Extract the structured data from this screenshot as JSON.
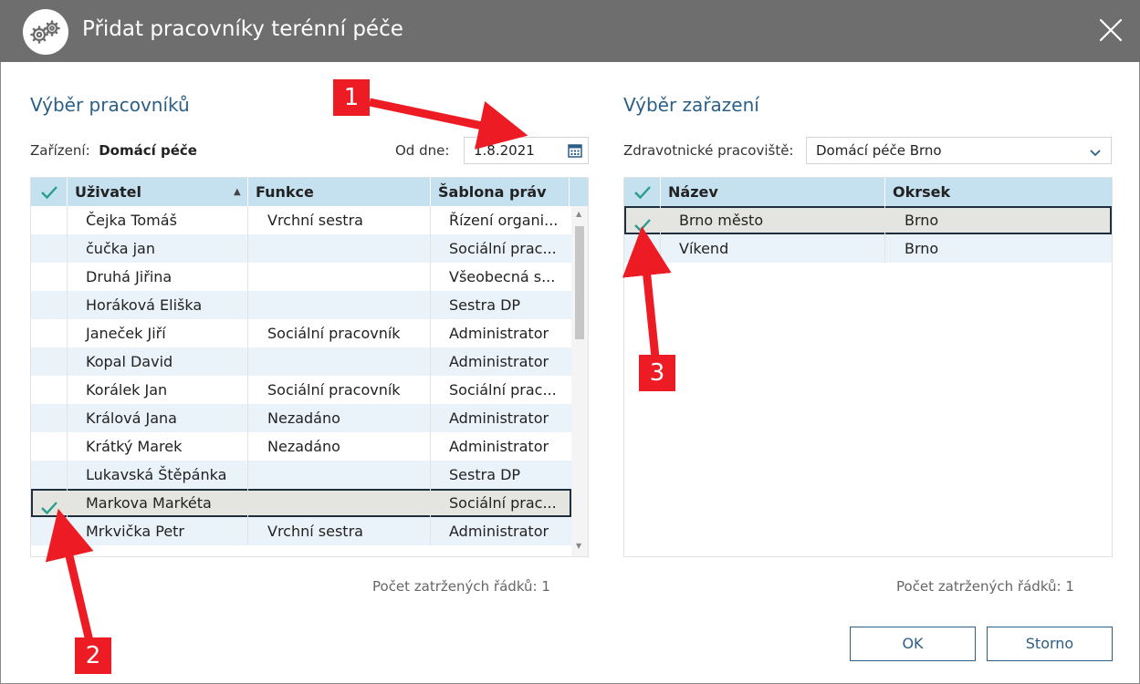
{
  "window": {
    "title": "Přidat pracovníky terénní péče"
  },
  "left": {
    "section_title": "Výběr pracovníků",
    "facility_label": "Zařízení:",
    "facility_value": "Domácí péče",
    "from_label": "Od dne:",
    "from_value": "1.8.2021",
    "columns": [
      "Uživatel",
      "Funkce",
      "Šablona práv"
    ],
    "rows": [
      {
        "name": "Čejka Tomáš",
        "function": "Vrchní sestra",
        "template": "Řízení organi...",
        "checked": false
      },
      {
        "name": "čučka jan",
        "function": "",
        "template": "Sociální prac...",
        "checked": false
      },
      {
        "name": "Druhá Jiřina",
        "function": "",
        "template": "Všeobecná s...",
        "checked": false
      },
      {
        "name": "Horáková Eliška",
        "function": "",
        "template": "Sestra DP",
        "checked": false
      },
      {
        "name": "Janeček Jiří",
        "function": "Sociální pracovník",
        "template": "Administrator",
        "checked": false
      },
      {
        "name": "Kopal David",
        "function": "",
        "template": "Administrator",
        "checked": false
      },
      {
        "name": "Korálek Jan",
        "function": "Sociální pracovník",
        "template": "Sociální prac...",
        "checked": false
      },
      {
        "name": "Králová Jana",
        "function": "Nezadáno",
        "template": "Administrator",
        "checked": false
      },
      {
        "name": "Krátký Marek",
        "function": "Nezadáno",
        "template": "Administrator",
        "checked": false
      },
      {
        "name": "Lukavská Štěpánka",
        "function": "",
        "template": "Sestra DP",
        "checked": false
      },
      {
        "name": "Markova Markéta",
        "function": "",
        "template": "Sociální prac...",
        "checked": true
      },
      {
        "name": "Mrkvička Petr",
        "function": "Vrchní sestra",
        "template": "Administrator",
        "checked": false
      }
    ],
    "count_text": "Počet zatržených řádků: 1"
  },
  "right": {
    "section_title": "Výběr zařazení",
    "workplace_label": "Zdravotnické pracoviště:",
    "workplace_value": "Domácí péče Brno",
    "columns": [
      "Název",
      "Okrsek"
    ],
    "rows": [
      {
        "name": "Brno město",
        "district": "Brno",
        "checked": true
      },
      {
        "name": "Víkend",
        "district": "Brno",
        "checked": false
      }
    ],
    "count_text": "Počet zatržených řádků: 1"
  },
  "buttons": {
    "ok": "OK",
    "cancel": "Storno"
  },
  "callouts": [
    "1",
    "2",
    "3"
  ],
  "colors": {
    "accent": "#2c5f86",
    "check": "#2a9d8f",
    "header_bg": "#c5e1ef",
    "row_alt": "#e9f3f9",
    "callout": "#ed1c24"
  }
}
